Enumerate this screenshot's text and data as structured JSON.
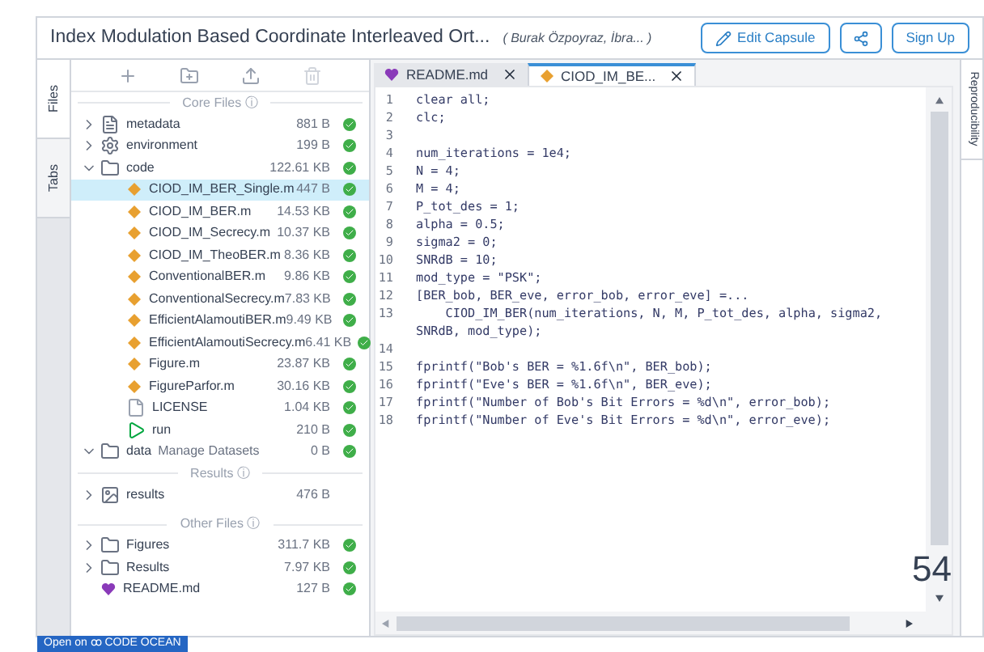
{
  "header": {
    "title": "Index Modulation Based Coordinate Interleaved Ort...",
    "authors": "( Burak Özpoyraz, İbra... )",
    "buttons": [
      {
        "kind": "edit",
        "label": "Edit Capsule"
      },
      {
        "kind": "share"
      },
      {
        "kind": "signup",
        "label": "Sign Up"
      }
    ]
  },
  "side_tabs": [
    {
      "label": "Files",
      "selected": true
    },
    {
      "label": "Tabs",
      "selected": false
    }
  ],
  "sections": [
    {
      "title": "Core Files ⓘ",
      "items": [
        {
          "kind": "metadata",
          "name": "metadata",
          "size": "881 B",
          "expanded": false,
          "synced": true
        },
        {
          "kind": "environment",
          "name": "environment",
          "size": "199 B",
          "expanded": false,
          "synced": true
        },
        {
          "kind": "folder",
          "name": "code",
          "size": "122.61 KB",
          "expanded": true,
          "synced": true,
          "children": [
            {
              "kind": "matlab",
              "name": "CIOD_IM_BER_Single.m",
              "size": "447 B",
              "selected": true,
              "synced": true
            },
            {
              "kind": "matlab",
              "name": "CIOD_IM_BER.m",
              "size": "14.53 KB",
              "selected": false,
              "synced": true
            },
            {
              "kind": "matlab",
              "name": "CIOD_IM_Secrecy.m",
              "size": "10.37 KB",
              "selected": false,
              "synced": true
            },
            {
              "kind": "matlab",
              "name": "CIOD_IM_TheoBER.m",
              "size": "8.36 KB",
              "selected": false,
              "synced": true
            },
            {
              "kind": "matlab",
              "name": "ConventionalBER.m",
              "size": "9.86 KB",
              "selected": false,
              "synced": true
            },
            {
              "kind": "matlab",
              "name": "ConventionalSecrecy.m",
              "size": "7.83 KB",
              "selected": false,
              "synced": true
            },
            {
              "kind": "matlab",
              "name": "EfficientAlamoutiBER.m",
              "size": "9.49 KB",
              "selected": false,
              "synced": true
            },
            {
              "kind": "matlab",
              "name": "EfficientAlamoutiSecrecy.m",
              "size": "6.41 KB",
              "selected": false,
              "synced": true
            },
            {
              "kind": "matlab",
              "name": "Figure.m",
              "size": "23.87 KB",
              "selected": false,
              "synced": true
            },
            {
              "kind": "matlab",
              "name": "FigureParfor.m",
              "size": "30.16 KB",
              "selected": false,
              "synced": true
            },
            {
              "kind": "file",
              "name": "LICENSE",
              "size": "1.04 KB",
              "selected": false,
              "synced": true
            },
            {
              "kind": "run",
              "name": "run",
              "size": "210 B",
              "selected": false,
              "synced": true
            }
          ]
        },
        {
          "kind": "folder",
          "name": "data",
          "note": "Manage Datasets",
          "size": "0 B",
          "expanded": true,
          "synced": true
        }
      ]
    },
    {
      "title": "Results ⓘ",
      "items": [
        {
          "kind": "results",
          "name": "results",
          "size": "476 B",
          "expanded": false,
          "synced": false
        }
      ]
    },
    {
      "title": "Other Files ⓘ",
      "items": [
        {
          "kind": "folder",
          "name": "Figures",
          "size": "311.7 KB",
          "expanded": false,
          "synced": true
        },
        {
          "kind": "folder",
          "name": "Results",
          "size": "7.97 KB",
          "expanded": false,
          "synced": true
        },
        {
          "kind": "markdown",
          "name": "README.md",
          "size": "127 B",
          "synced": true
        }
      ]
    }
  ],
  "editor_tabs": [
    {
      "kind": "markdown",
      "label": "README.md",
      "selected": false
    },
    {
      "kind": "matlab",
      "label": "CIOD_IM_BE...",
      "selected": true
    }
  ],
  "code_lines": [
    {
      "n": "1",
      "text": "clear all;"
    },
    {
      "n": "2",
      "text": "clc;"
    },
    {
      "n": "3"
    },
    {
      "n": "4",
      "text": "num_iterations = 1e4;"
    },
    {
      "n": "5",
      "text": "N = 4;"
    },
    {
      "n": "6",
      "text": "M = 4;"
    },
    {
      "n": "7",
      "text": "P_tot_des = 1;"
    },
    {
      "n": "8",
      "text": "alpha = 0.5;"
    },
    {
      "n": "9",
      "text": "sigma2 = 0;"
    },
    {
      "n": "10",
      "text": "SNRdB = 10;"
    },
    {
      "n": "11",
      "text": "mod_type = \"PSK\";"
    },
    {
      "n": "12",
      "text": "[BER_bob, BER_eve, error_bob, error_eve] =..."
    },
    {
      "n": "13",
      "text": "    CIOD_IM_BER(num_iterations, N, M, P_tot_des, alpha, sigma2, SNRdB, mod_type);"
    },
    {
      "n": "14"
    },
    {
      "n": "15",
      "text": "fprintf(\"Bob's BER = %1.6f\\n\", BER_bob);"
    },
    {
      "n": "16",
      "text": "fprintf(\"Eve's BER = %1.6f\\n\", BER_eve);"
    },
    {
      "n": "17",
      "text": "fprintf(\"Number of Bob's Bit Errors = %d\\n\", error_bob);"
    },
    {
      "n": "18",
      "text": "fprintf(\"Number of Eve's Bit Errors = %d\\n\", error_eve);"
    }
  ],
  "page_number": "54",
  "right_tab": "Reproducibility",
  "badge": "Open on ꝏ CODE OCEAN"
}
